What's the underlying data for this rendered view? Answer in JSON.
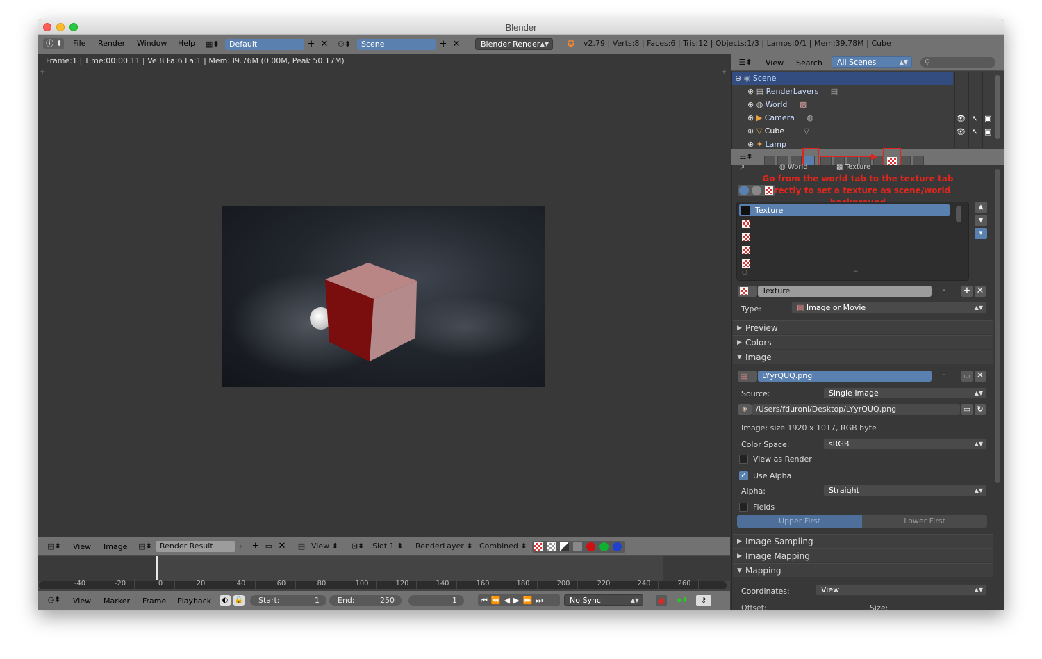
{
  "window": {
    "title": "Blender"
  },
  "info_header": {
    "menus": [
      "File",
      "Render",
      "Window",
      "Help"
    ],
    "layout": "Default",
    "scene": "Scene",
    "engine": "Blender Render",
    "stats": "v2.79 | Verts:8 | Faces:6 | Tris:12 | Objects:1/3 | Lamps:0/1 | Mem:39.78M | Cube"
  },
  "image_editor": {
    "info_text": "Frame:1 | Time:00:00.11 | Ve:8 Fa:6 La:1 | Mem:39.76M (0.00M, Peak 50.17M)",
    "header": {
      "view_label": "View",
      "image_label": "Image",
      "image_name": "Render Result",
      "fake_user": "F",
      "view_mode": "View",
      "slot": "Slot 1",
      "render_layer": "RenderLayer",
      "pass": "Combined"
    }
  },
  "timeline": {
    "ticks": [
      "-40",
      "-20",
      "0",
      "20",
      "40",
      "60",
      "80",
      "100",
      "120",
      "140",
      "160",
      "180",
      "200",
      "220",
      "240",
      "260"
    ],
    "menus": [
      "View",
      "Marker",
      "Frame",
      "Playback"
    ],
    "start_label": "Start:",
    "start_value": "1",
    "end_label": "End:",
    "end_value": "250",
    "current_frame": "1",
    "sync": "No Sync"
  },
  "outliner": {
    "view_label": "View",
    "search_label": "Search",
    "filter": "All Scenes",
    "items": [
      "Scene",
      "RenderLayers",
      "World",
      "Camera",
      "Cube",
      "Lamp"
    ]
  },
  "properties": {
    "context_world": "World",
    "context_texture": "Texture",
    "annotation": "Go from the world tab to the texture tab directly to set a texture as scene/world background",
    "slots": [
      "Texture"
    ],
    "texture_name": "Texture",
    "fake_user": "F",
    "type_label": "Type:",
    "type_value": "Image or Movie",
    "panel_preview": "Preview",
    "panel_colors": "Colors",
    "panel_image": "Image",
    "image_name": "LYyrQUQ.png",
    "source_label": "Source:",
    "source_value": "Single Image",
    "filepath": "/Users/fduroni/Desktop/LYyrQUQ.png",
    "image_info": "Image: size 1920 x 1017, RGB byte",
    "color_space_label": "Color Space:",
    "color_space_value": "sRGB",
    "view_as_render": "View as Render",
    "use_alpha": "Use Alpha",
    "alpha_label": "Alpha:",
    "alpha_value": "Straight",
    "fields": "Fields",
    "upper_first": "Upper First",
    "lower_first": "Lower First",
    "panel_image_sampling": "Image Sampling",
    "panel_image_mapping": "Image Mapping",
    "panel_mapping": "Mapping",
    "coordinates_label": "Coordinates:",
    "coordinates_value": "View",
    "offset_label": "Offset:",
    "size_label": "Size:"
  },
  "colors": {
    "accent": "#5a80b0",
    "annotation": "#e0261c",
    "outliner_selected": "#334d80"
  }
}
